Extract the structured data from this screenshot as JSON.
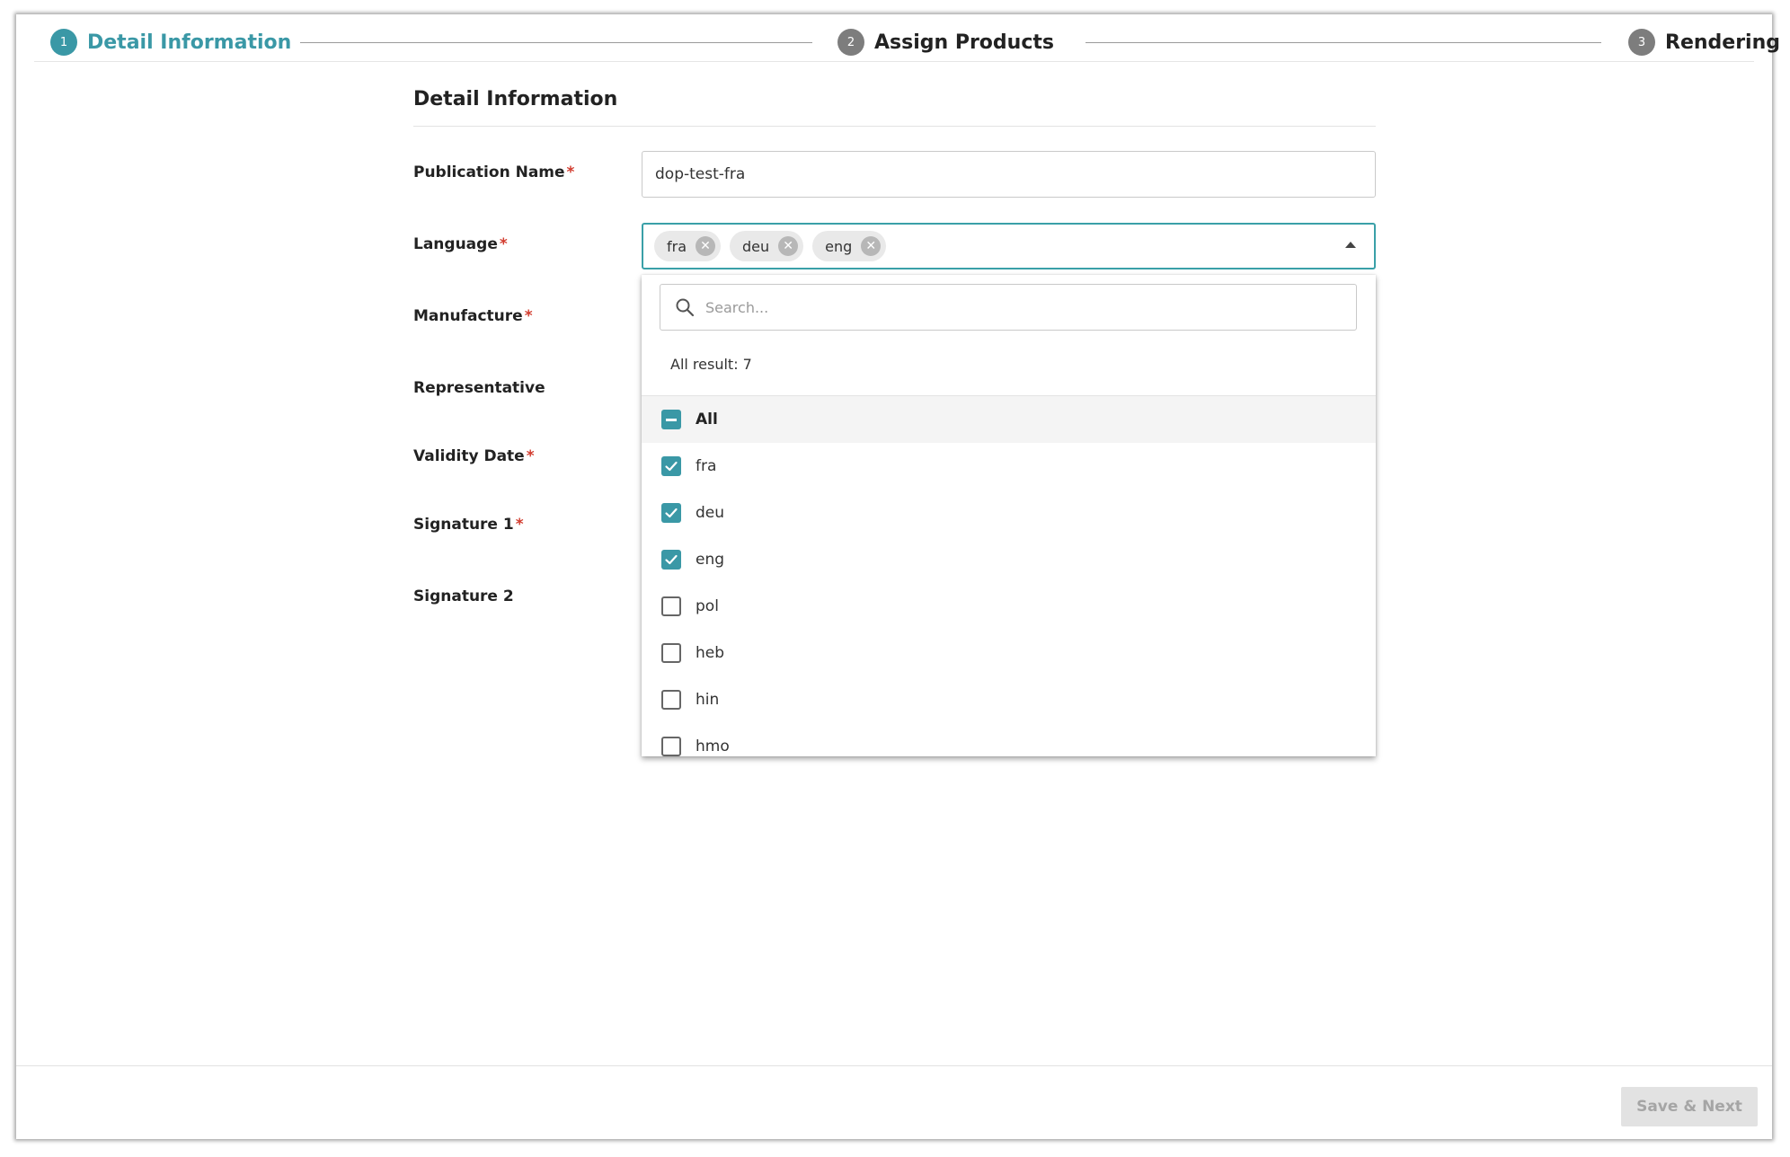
{
  "stepper": {
    "steps": [
      {
        "number": "1",
        "label": "Detail Information",
        "state": "active"
      },
      {
        "number": "2",
        "label": "Assign Products",
        "state": "inactive"
      },
      {
        "number": "3",
        "label": "Rendering",
        "state": "inactive"
      }
    ]
  },
  "colors": {
    "accent": "#3a98a6",
    "required": "#d23c2f",
    "step_inactive": "#7d7d7d"
  },
  "form": {
    "title": "Detail Information",
    "required_marker": "*",
    "fields": {
      "publication_name": {
        "label": "Publication Name",
        "required": true,
        "value": "dop-test-fra"
      },
      "language": {
        "label": "Language",
        "required": true
      },
      "manufacture": {
        "label": "Manufacture",
        "required": true
      },
      "representative": {
        "label": "Representative",
        "required": false
      },
      "validity_date": {
        "label": "Validity Date",
        "required": true
      },
      "signature_1": {
        "label": "Signature 1",
        "required": true
      },
      "signature_2": {
        "label": "Signature 2",
        "required": false
      }
    }
  },
  "language_select": {
    "chips": [
      {
        "label": "fra",
        "remove_icon": "close-circle-icon"
      },
      {
        "label": "deu",
        "remove_icon": "close-circle-icon"
      },
      {
        "label": "eng",
        "remove_icon": "close-circle-icon"
      }
    ],
    "caret_icon": "caret-up-icon",
    "dropdown": {
      "search_placeholder": "Search...",
      "search_icon": "search-icon",
      "result_count": "All result: 7",
      "options": [
        {
          "label": "All",
          "state": "partial"
        },
        {
          "label": "fra",
          "state": "checked"
        },
        {
          "label": "deu",
          "state": "checked"
        },
        {
          "label": "eng",
          "state": "checked"
        },
        {
          "label": "pol",
          "state": "unchecked"
        },
        {
          "label": "heb",
          "state": "unchecked"
        },
        {
          "label": "hin",
          "state": "unchecked"
        },
        {
          "label": "hmo",
          "state": "unchecked"
        }
      ]
    }
  },
  "footer": {
    "save_label": "Save & Next",
    "save_enabled": false
  }
}
